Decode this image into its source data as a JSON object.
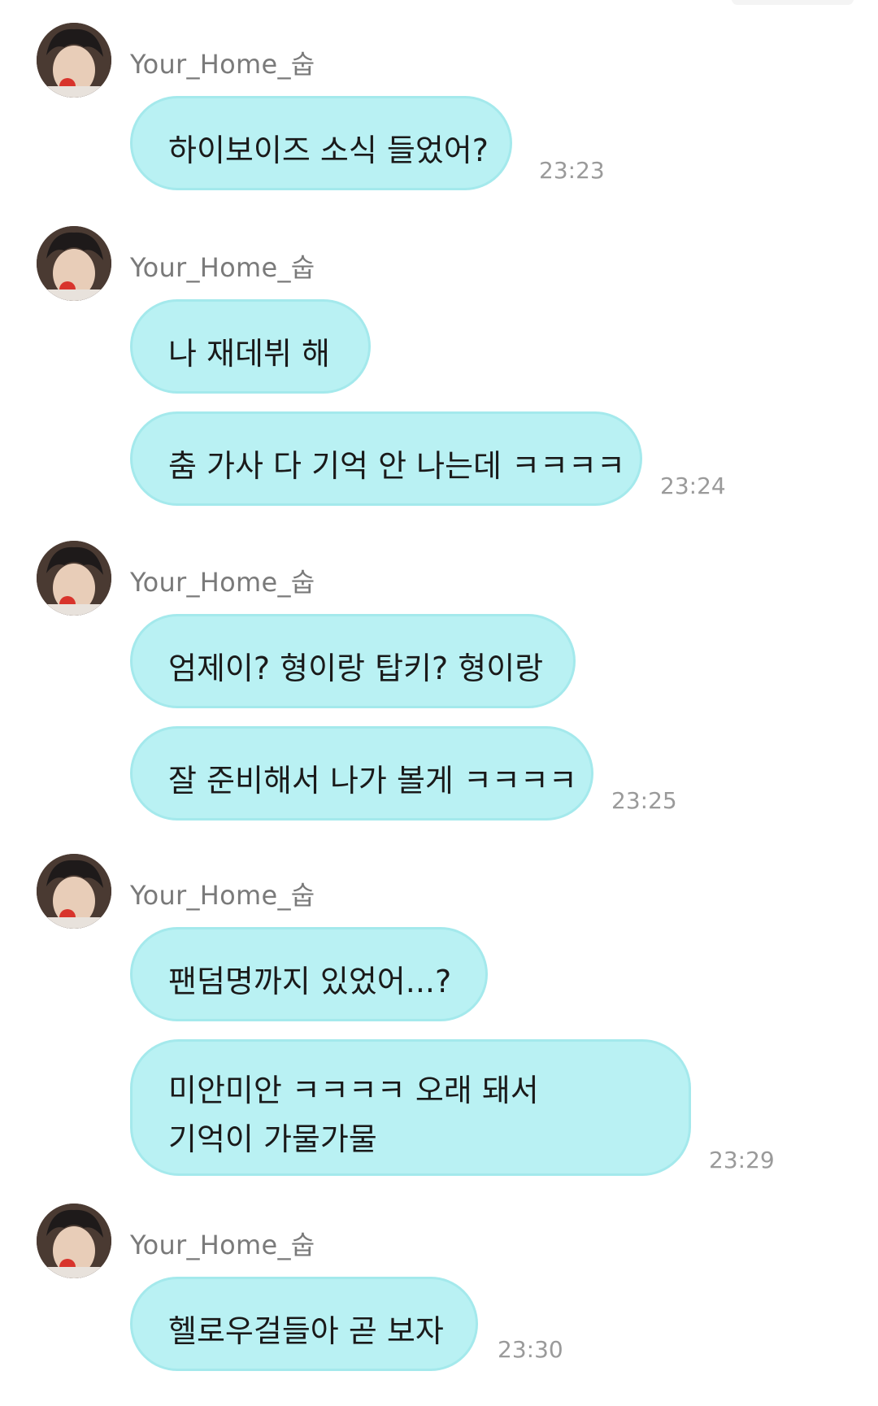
{
  "sender_name": "Your_Home_숩",
  "groups": [
    {
      "messages": [
        "하이보이즈 소식 들었어?"
      ],
      "time": "23:23"
    },
    {
      "messages": [
        "나 재데뷔 해",
        "춤 가사 다 기억 안 나는데 ㅋㅋㅋㅋ"
      ],
      "time": "23:24"
    },
    {
      "messages": [
        "엄제이? 형이랑 탑키? 형이랑",
        "잘 준비해서 나가 볼게 ㅋㅋㅋㅋ"
      ],
      "time": "23:25"
    },
    {
      "messages": [
        "팬덤명까지 있었어...?",
        "미안미안 ㅋㅋㅋㅋ 오래 돼서 기억이 가물가물"
      ],
      "time": "23:29"
    },
    {
      "messages": [
        "헬로우걸들아 곧 보자"
      ],
      "time": "23:30"
    }
  ],
  "colors": {
    "bubble": "#b9f1f3",
    "bubble_border": "#a4e9ec",
    "sender": "#7a7a7a",
    "time": "#9a9a9a"
  }
}
